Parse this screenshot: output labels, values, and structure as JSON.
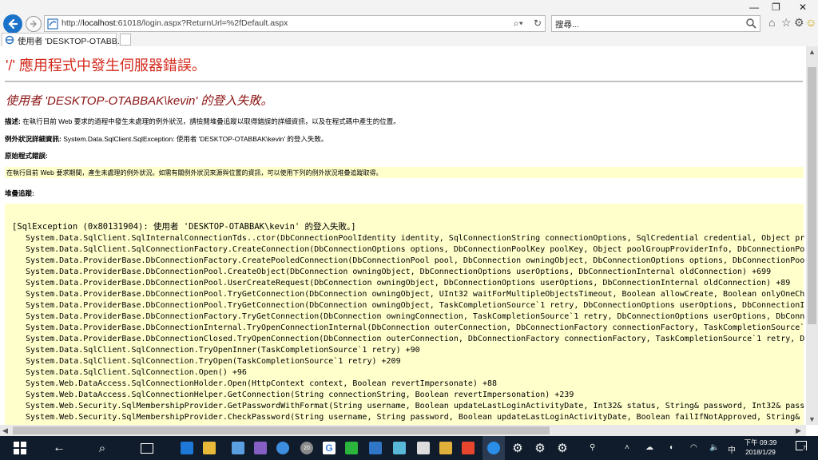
{
  "browser": {
    "url_prefix": "http://",
    "url_host": "localhost",
    "url_rest": ":61018/login.aspx?ReturnUrl=%2fDefault.aspx",
    "search_placeholder": "搜尋...",
    "tab_title": "使用者 'DESKTOP-OTABB...",
    "accent_color": "#1a73c9"
  },
  "page": {
    "heading": "'/' 應用程式中發生伺服器錯誤。",
    "subheading": "使用者 'DESKTOP-OTABBAK\\kevin' 的登入失敗。",
    "description_label": "描述:",
    "description_text": " 在執行目前 Web 要求的過程中發生未處理的例外狀況，請檢閱堆疊追蹤以取得錯誤的詳細資訊，以及在程式碼中產生的位置。",
    "exception_label": "例外狀況詳細資訊:",
    "exception_text": " System.Data.SqlClient.SqlException: 使用者 'DESKTOP-OTABBAK\\kevin' 的登入失敗。",
    "source_label": "原始程式錯誤:",
    "source_text": "在執行目前 Web 要求期間，產生未處理的例外狀況。如需有關例外狀況來源與位置的資訊，可以使用下列的例外狀況堆疊追蹤取得。",
    "stack_label": "堆疊追蹤:",
    "stack_header": "[SqlException (0x80131904): 使用者 'DESKTOP-OTABBAK\\kevin' 的登入失敗。]",
    "stack_lines": [
      "System.Data.SqlClient.SqlInternalConnectionTds..ctor(DbConnectionPoolIdentity identity, SqlConnectionString connectionOptions, SqlCredential credential, Object pr",
      "System.Data.SqlClient.SqlConnectionFactory.CreateConnection(DbConnectionOptions options, DbConnectionPoolKey poolKey, Object poolGroupProviderInfo, DbConnectionPo",
      "System.Data.ProviderBase.DbConnectionFactory.CreatePooledConnection(DbConnectionPool pool, DbConnection owningObject, DbConnectionOptions options, DbConnectionPoo",
      "System.Data.ProviderBase.DbConnectionPool.CreateObject(DbConnection owningObject, DbConnectionOptions userOptions, DbConnectionInternal oldConnection) +699",
      "System.Data.ProviderBase.DbConnectionPool.UserCreateRequest(DbConnection owningObject, DbConnectionOptions userOptions, DbConnectionInternal oldConnection) +89",
      "System.Data.ProviderBase.DbConnectionPool.TryGetConnection(DbConnection owningObject, UInt32 waitForMultipleObjectsTimeout, Boolean allowCreate, Boolean onlyOneCh",
      "System.Data.ProviderBase.DbConnectionPool.TryGetConnection(DbConnection owningObject, TaskCompletionSource`1 retry, DbConnectionOptions userOptions, DbConnectionI",
      "System.Data.ProviderBase.DbConnectionFactory.TryGetConnection(DbConnection owningConnection, TaskCompletionSource`1 retry, DbConnectionOptions userOptions, DbConn",
      "System.Data.ProviderBase.DbConnectionInternal.TryOpenConnectionInternal(DbConnection outerConnection, DbConnectionFactory connectionFactory, TaskCompletionSource`",
      "System.Data.ProviderBase.DbConnectionClosed.TryOpenConnection(DbConnection outerConnection, DbConnectionFactory connectionFactory, TaskCompletionSource`1 retry, D",
      "System.Data.SqlClient.SqlConnection.TryOpenInner(TaskCompletionSource`1 retry) +90",
      "System.Data.SqlClient.SqlConnection.TryOpen(TaskCompletionSource`1 retry) +209",
      "System.Data.SqlClient.SqlConnection.Open() +96",
      "System.Web.DataAccess.SqlConnectionHolder.Open(HttpContext context, Boolean revertImpersonate) +88",
      "System.Web.DataAccess.SqlConnectionHelper.GetConnection(String connectionString, Boolean revertImpersonation) +239",
      "System.Web.Security.SqlMembershipProvider.GetPasswordWithFormat(String username, Boolean updateLastLoginActivityDate, Int32& status, String& password, Int32& pass",
      "System.Web.Security.SqlMembershipProvider.CheckPassword(String username, String password, Boolean updateLastLoginActivityDate, Boolean failIfNotApproved, String&"
    ]
  },
  "taskbar": {
    "clock_time": "下午 09:39",
    "clock_date": "2018/1/29",
    "notification_count": "7",
    "badge_count": "20"
  }
}
